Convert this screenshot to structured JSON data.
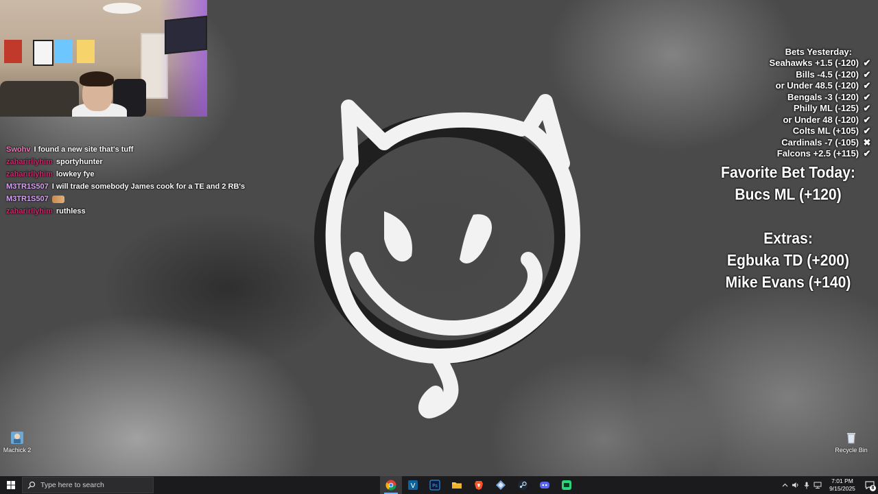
{
  "chat": {
    "messages": [
      {
        "user": "Swohv",
        "user_color": "#f07ab8",
        "text": "I found a new site that's tuff"
      },
      {
        "user": "zaharirllyhim",
        "user_color": "#d2286e",
        "text": "sportyhunter"
      },
      {
        "user": "zaharirllyhim",
        "user_color": "#d2286e",
        "text": "lowkey fye"
      },
      {
        "user": "M3TR1S507",
        "user_color": "#d9a6f5",
        "text": "I will trade somebody James cook for a TE and 2 RB's"
      },
      {
        "user": "M3TR1S507",
        "user_color": "#d9a6f5",
        "text": ""
      },
      {
        "user": "zaharirllyhim",
        "user_color": "#d2286e",
        "text": "ruthless"
      }
    ]
  },
  "bets": {
    "title": "Bets Yesterday:",
    "items": [
      {
        "text": "Seahawks +1.5 (-120)",
        "mark": "✔"
      },
      {
        "text": "Bills -4.5 (-120)",
        "mark": "✔"
      },
      {
        "text": "or Under 48.5 (-120)",
        "mark": "✔"
      },
      {
        "text": "Bengals -3 (-120)",
        "mark": "✔"
      },
      {
        "text": "Philly ML (-125)",
        "mark": "✔"
      },
      {
        "text": "or Under 48 (-120)",
        "mark": "✔"
      },
      {
        "text": "Colts ML (+105)",
        "mark": "✔"
      },
      {
        "text": "Cardinals -7 (-105)",
        "mark": "✖"
      },
      {
        "text": "Falcons +2.5 (+115)",
        "mark": "✔"
      }
    ],
    "favorite_title": "Favorite Bet Today:",
    "favorite_value": "Bucs ML (+120)",
    "extras_title": "Extras:",
    "extras": [
      "Egbuka TD (+200)",
      "Mike Evans (+140)"
    ]
  },
  "desktop": {
    "icon_left_label": "Machick 2",
    "icon_right_label": "Recycle Bin"
  },
  "taskbar": {
    "search_placeholder": "Type here to search",
    "time": "7:01 PM",
    "date": "9/15/2025",
    "notification_count": "8",
    "apps": [
      "chrome-icon",
      "vscode-icon",
      "photoshop-icon",
      "file-explorer-icon",
      "brave-icon",
      "app-diamond-icon",
      "steam-icon",
      "discord-icon",
      "app-green-icon"
    ]
  }
}
